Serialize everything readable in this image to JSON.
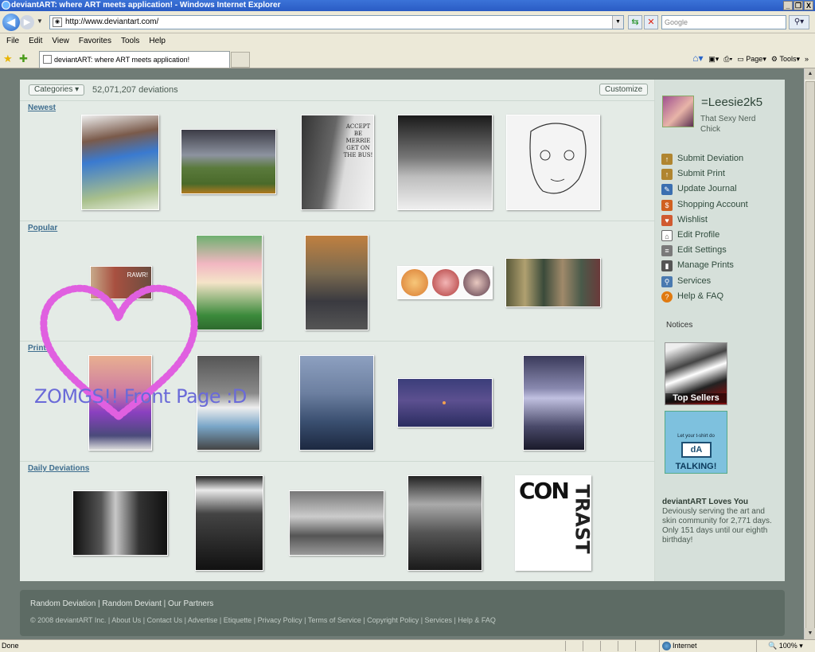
{
  "window": {
    "title": "deviantART: where ART meets application! - Windows Internet Explorer",
    "buttons": [
      "_",
      "❐",
      "X"
    ]
  },
  "address_bar": {
    "url": "http://www.deviantart.com/",
    "search_placeholder": "Google"
  },
  "menu": [
    "File",
    "Edit",
    "View",
    "Favorites",
    "Tools",
    "Help"
  ],
  "tab": {
    "title": "deviantART: where ART meets application!"
  },
  "command_bar": {
    "page_label": "Page",
    "tools_label": "Tools"
  },
  "main": {
    "categories_label": "Categories ▾",
    "deviation_count": "52,071,207 deviations",
    "customize_label": "Customize",
    "sections": [
      {
        "title": "Newest"
      },
      {
        "title": "Popular"
      },
      {
        "title": "Prints"
      },
      {
        "title": "Daily Deviations"
      }
    ],
    "thumb_texts": {
      "rawr": "RAWR!",
      "poster": "ACCEPT BE MERRIE GET ON THE BUS!"
    }
  },
  "overlay": {
    "zomg_text": "ZOMGS!! Front Page :D"
  },
  "sidebar": {
    "username": "=Leesie2k5",
    "tagline": "That Sexy Nerd Chick",
    "menu": [
      {
        "label": "Submit Deviation",
        "icon": "submit-deviation-icon",
        "color": "#b08530"
      },
      {
        "label": "Submit Print",
        "icon": "submit-print-icon",
        "color": "#b08530"
      },
      {
        "label": "Update Journal",
        "icon": "journal-icon",
        "color": "#3b6fb0"
      },
      {
        "label": "Shopping Account",
        "icon": "shopping-icon",
        "color": "#d06020"
      },
      {
        "label": "Wishlist",
        "icon": "wishlist-icon",
        "color": "#d05a30"
      },
      {
        "label": "Edit Profile",
        "icon": "edit-profile-icon",
        "color": "#8a8070"
      },
      {
        "label": "Edit Settings",
        "icon": "edit-settings-icon",
        "color": "#7a7a7a"
      },
      {
        "label": "Manage Prints",
        "icon": "manage-prints-icon",
        "color": "#555"
      },
      {
        "label": "Services",
        "icon": "services-icon",
        "color": "#4a7ab0"
      },
      {
        "label": "Help & FAQ",
        "icon": "help-icon",
        "color": "#e07a10"
      }
    ],
    "notices_label": "Notices",
    "ad_top_sellers": "Top Sellers",
    "ad_talking_small": "Let your t-shirt do",
    "ad_talking_big": "TALKING!",
    "loves_title": "deviantART Loves You",
    "loves_text": "Deviously serving the art and skin community for 2,771 days. Only 151 days until our eighth birthday!"
  },
  "footer": {
    "links1": "Random Deviation | Random Deviant | Our Partners",
    "links2": "© 2008 deviantART Inc. | About Us | Contact Us | Advertise | Etiquette | Privacy Policy | Terms of Service | Copyright Policy | Services | Help & FAQ"
  },
  "status": {
    "text": "Done",
    "zone": "Internet",
    "zoom": "100%"
  }
}
